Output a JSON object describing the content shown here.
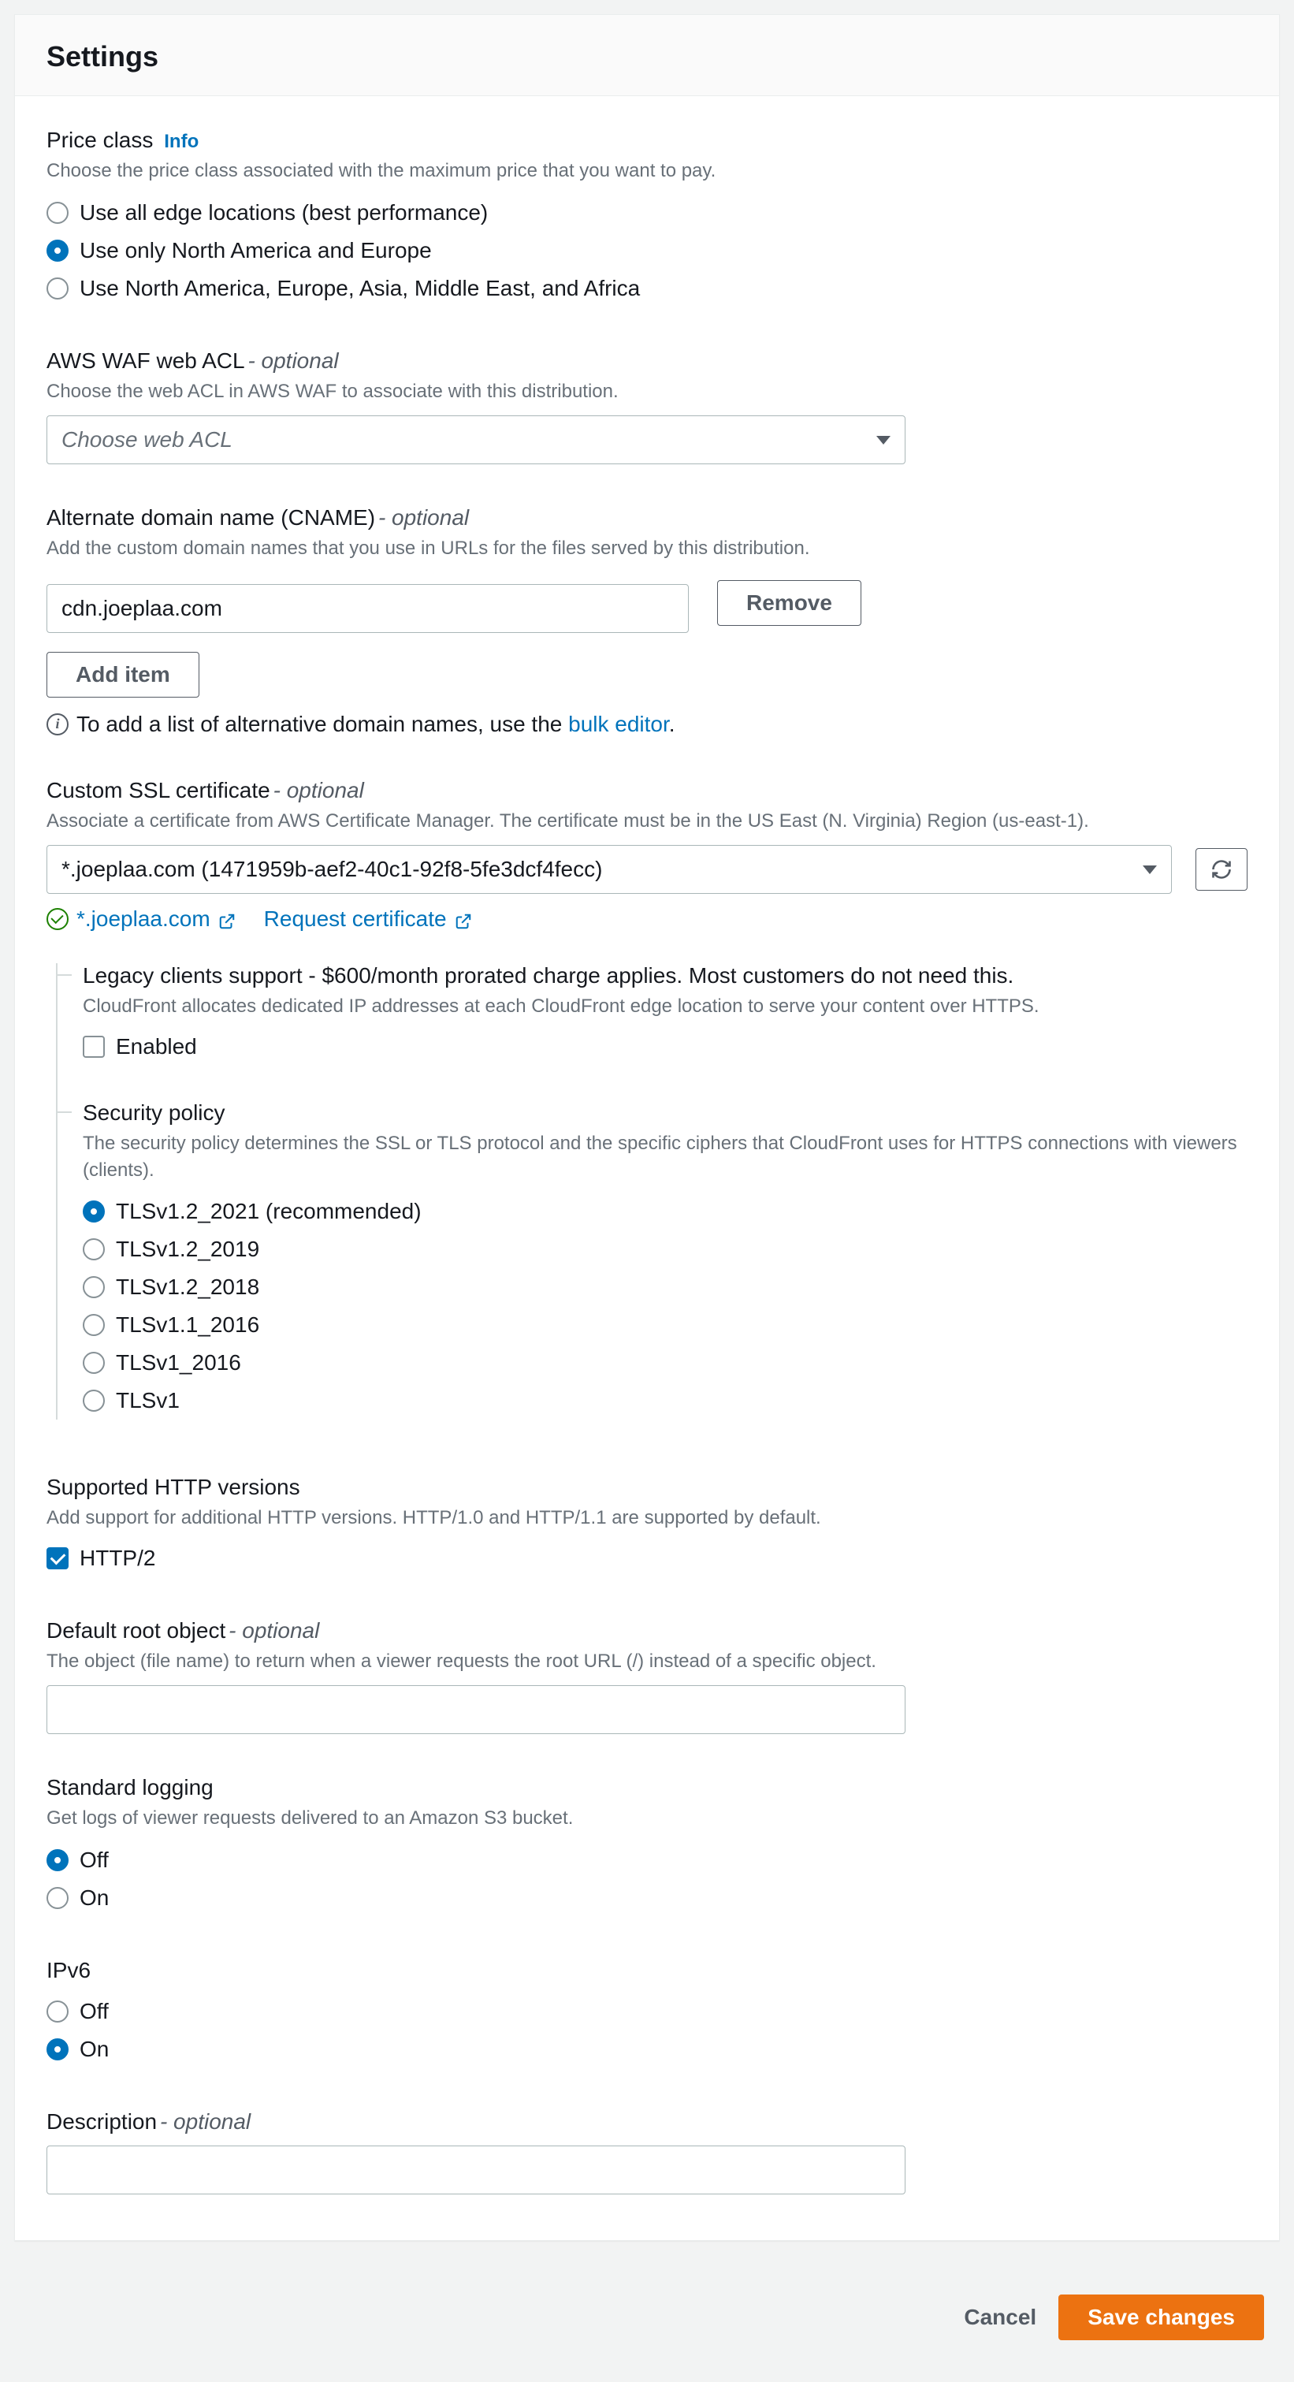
{
  "header": {
    "title": "Settings"
  },
  "price_class": {
    "label": "Price class",
    "info": "Info",
    "desc": "Choose the price class associated with the maximum price that you want to pay.",
    "options": [
      "Use all edge locations (best performance)",
      "Use only North America and Europe",
      "Use North America, Europe, Asia, Middle East, and Africa"
    ],
    "selected": 1
  },
  "waf": {
    "label": "AWS WAF web ACL",
    "optional": "- optional",
    "desc": "Choose the web ACL in AWS WAF to associate with this distribution.",
    "placeholder": "Choose web ACL"
  },
  "cname": {
    "label": "Alternate domain name (CNAME)",
    "optional": "- optional",
    "desc": "Add the custom domain names that you use in URLs for the files served by this distribution.",
    "value": "cdn.joeplaa.com",
    "remove": "Remove",
    "add_item": "Add item",
    "bulk_pre": "To add a list of alternative domain names, use the ",
    "bulk_link": "bulk editor",
    "bulk_post": "."
  },
  "ssl": {
    "label": "Custom SSL certificate",
    "optional": "- optional",
    "desc": "Associate a certificate from AWS Certificate Manager. The certificate must be in the US East (N. Virginia) Region (us-east-1).",
    "selected": "*.joeplaa.com (1471959b-aef2-40c1-92f8-5fe3dcf4fecc)",
    "cert_link": "*.joeplaa.com",
    "request_link": "Request certificate"
  },
  "legacy": {
    "label": "Legacy clients support - $600/month prorated charge applies. Most customers do not need this.",
    "desc": "CloudFront allocates dedicated IP addresses at each CloudFront edge location to serve your content over HTTPS.",
    "checkbox_label": "Enabled"
  },
  "security_policy": {
    "label": "Security policy",
    "desc": "The security policy determines the SSL or TLS protocol and the specific ciphers that CloudFront uses for HTTPS connections with viewers (clients).",
    "options": [
      "TLSv1.2_2021 (recommended)",
      "TLSv1.2_2019",
      "TLSv1.2_2018",
      "TLSv1.1_2016",
      "TLSv1_2016",
      "TLSv1"
    ],
    "selected": 0
  },
  "http_versions": {
    "label": "Supported HTTP versions",
    "desc": "Add support for additional HTTP versions. HTTP/1.0 and HTTP/1.1 are supported by default.",
    "checkbox_label": "HTTP/2",
    "checked": true
  },
  "root_object": {
    "label": "Default root object",
    "optional": "- optional",
    "desc": "The object (file name) to return when a viewer requests the root URL (/) instead of a specific object."
  },
  "logging": {
    "label": "Standard logging",
    "desc": "Get logs of viewer requests delivered to an Amazon S3 bucket.",
    "options": [
      "Off",
      "On"
    ],
    "selected": 0
  },
  "ipv6": {
    "label": "IPv6",
    "options": [
      "Off",
      "On"
    ],
    "selected": 1
  },
  "description": {
    "label": "Description",
    "optional": "- optional"
  },
  "footer": {
    "cancel": "Cancel",
    "save": "Save changes"
  }
}
